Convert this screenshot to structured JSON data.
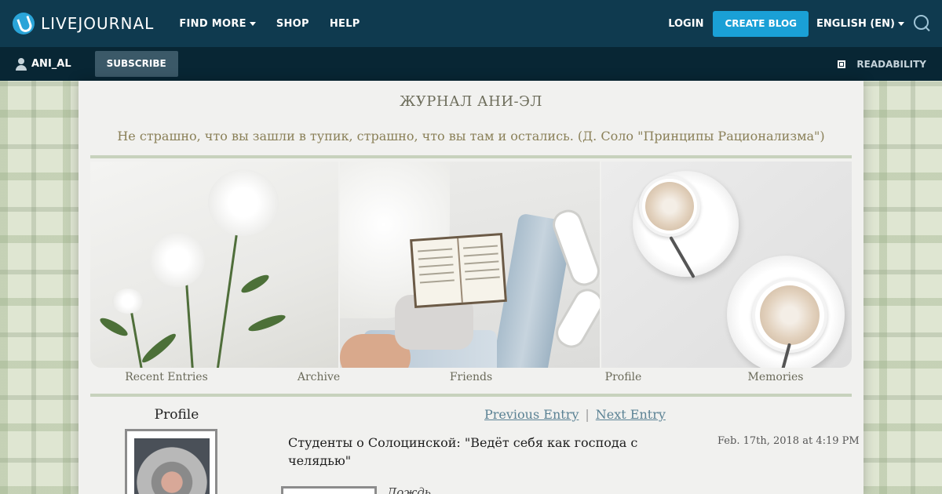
{
  "topbar": {
    "logo": "LIVEJOURNAL",
    "nav": [
      {
        "label": "FIND MORE",
        "dropdown": true
      },
      {
        "label": "SHOP",
        "dropdown": false
      },
      {
        "label": "HELP",
        "dropdown": false
      }
    ],
    "login": "LOGIN",
    "create_blog": "CREATE BLOG",
    "language": "ENGLISH (EN)"
  },
  "subbar": {
    "username": "ANI_AL",
    "subscribe": "SUBSCRIBE",
    "readability": "READABILITY"
  },
  "journal": {
    "title": "ЖУРНАЛ АНИ-ЭЛ",
    "subtitle": "Не страшно, что вы зашли в тупик, страшно, что вы там и остались. (Д. Соло \"Принципы Рационализма\")",
    "menu": [
      "Recent Entries",
      "Archive",
      "Friends",
      "Profile",
      "Memories"
    ]
  },
  "sidebar": {
    "profile_heading": "Profile"
  },
  "entry": {
    "prev": "Previous Entry",
    "separator": "|",
    "next": "Next Entry",
    "title": "Студенты о Солоцинской: \"Ведёт себя как господа с челядью\"",
    "date": "Feb. 17th, 2018 at 4:19 PM",
    "snippet": "Дождь"
  },
  "colors": {
    "topbar": "#0f3a4f",
    "subbar": "#082634",
    "accent": "#1aa0d6",
    "link": "#5b8294"
  }
}
